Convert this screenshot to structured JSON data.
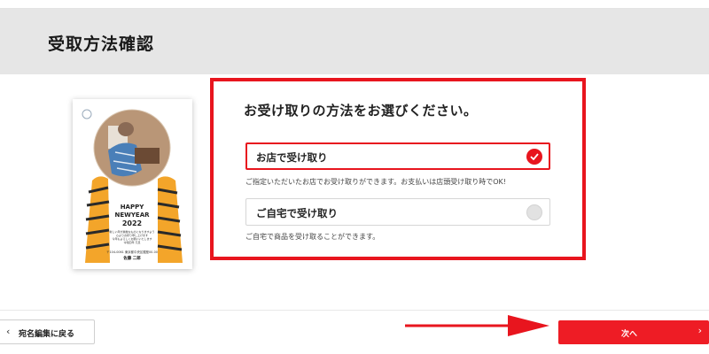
{
  "header": {
    "title": "受取方法確認"
  },
  "card": {
    "greeting_line1": "HAPPY",
    "greeting_line2": "NEWYEAR",
    "greeting_year": "2022",
    "message": [
      "新しい年が素敵なものになりますよう",
      "心よりお祈り申し上げます",
      "今年もよろしくお願いいたします",
      "令和四年 元旦"
    ],
    "address": "〒104-0061 東京都中央区銀座00-00",
    "name": "佐藤 二郎"
  },
  "panel": {
    "title": "お受け取りの方法をお選びください。",
    "options": [
      {
        "label": "お店で受け取り",
        "selected": true,
        "description": "ご指定いただいたお店でお受け取りができます。お支払いは店頭受け取り時でOK!"
      },
      {
        "label": "ご自宅で受け取り",
        "selected": false,
        "description": "ご自宅で商品を受け取ることができます。"
      }
    ]
  },
  "footer": {
    "back_label": "宛名編集に戻る",
    "next_label": "次へ"
  },
  "colors": {
    "accent": "#e8151e",
    "header_bg": "#e6e6e6"
  }
}
